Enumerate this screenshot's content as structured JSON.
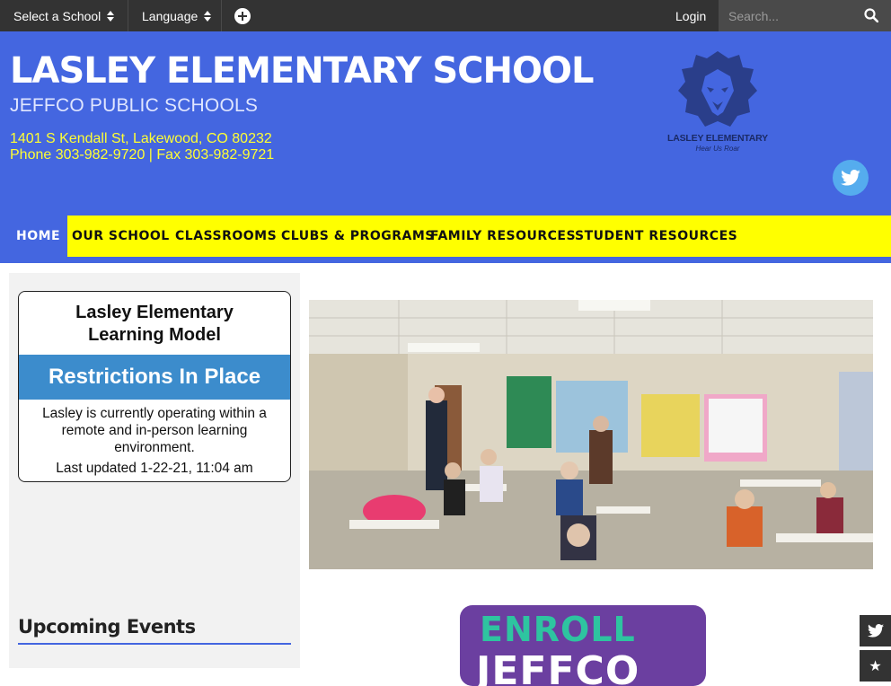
{
  "topbar": {
    "select_school": "Select a School",
    "language": "Language",
    "login": "Login",
    "search_placeholder": "Search..."
  },
  "header": {
    "school_name": "LASLEY ELEMENTARY SCHOOL",
    "district": "JEFFCO PUBLIC SCHOOLS",
    "address": "1401 S Kendall St, Lakewood, CO 80232",
    "phone_fax": "Phone 303-982-9720 | Fax 303-982-9721",
    "logo_name": "LASLEY ELEMENTARY",
    "logo_tagline": "Hear Us Roar"
  },
  "nav": {
    "items": [
      {
        "label": "HOME",
        "active": true
      },
      {
        "label": "OUR SCHOOL"
      },
      {
        "label": "CLASSROOMS"
      },
      {
        "label": "CLUBS & PROGRAMS"
      },
      {
        "label": "FAMILY RESOURCES"
      },
      {
        "label": "STUDENT RESOURCES"
      }
    ]
  },
  "learning_model": {
    "title_line1": "Lasley Elementary",
    "title_line2": "Learning Model",
    "status": "Restrictions In Place",
    "description": "Lasley is currently operating within a remote and in-person learning environment.",
    "updated": "Last updated 1-22-21, 11:04 am"
  },
  "events": {
    "title": "Upcoming Events"
  },
  "enroll": {
    "line1": "ENROLL",
    "line2": "JEFFCO"
  },
  "colors": {
    "brand_blue": "#4466e0",
    "nav_yellow": "#ffff00",
    "status_blue": "#3c8ccc",
    "twitter": "#55acee",
    "enroll_purple": "#6b3fa0",
    "enroll_teal": "#2ec4a0"
  },
  "icons": {
    "plus": "plus-circle-icon",
    "search": "search-icon",
    "twitter": "twitter-icon",
    "star": "star-icon"
  }
}
